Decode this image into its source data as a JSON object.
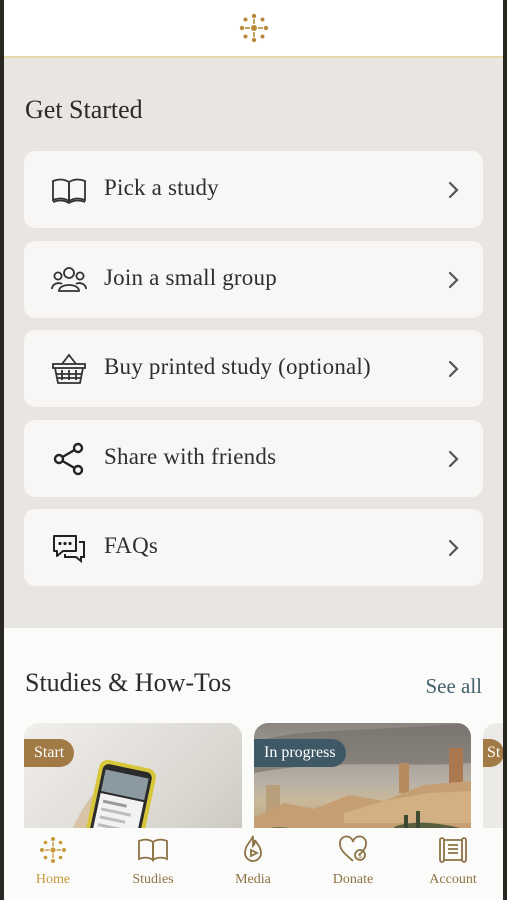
{
  "colors": {
    "accent": "#b7893a",
    "panel": "#e9e6e1",
    "card": "#f8f7f5",
    "link": "#44606b"
  },
  "header": {
    "logo_icon": "sunburst-logo-icon"
  },
  "get_started": {
    "title": "Get Started",
    "items": [
      {
        "label": "Pick a study",
        "icon": "book-open-icon"
      },
      {
        "label": "Join a small group",
        "icon": "group-icon"
      },
      {
        "label": "Buy printed study (optional)",
        "icon": "basket-icon"
      },
      {
        "label": "Share with friends",
        "icon": "share-icon"
      },
      {
        "label": "FAQs",
        "icon": "chat-bubbles-icon"
      }
    ]
  },
  "studies": {
    "title": "Studies & How-Tos",
    "see_all": "See all",
    "cards": [
      {
        "badge": "Start",
        "badge_color": "#a27a45"
      },
      {
        "badge": "In progress",
        "badge_color": "#3f5866"
      },
      {
        "badge": "St",
        "badge_color": "#a27a45"
      }
    ]
  },
  "tabbar": {
    "tabs": [
      {
        "label": "Home",
        "icon": "sunburst-icon",
        "active": true
      },
      {
        "label": "Studies",
        "icon": "book-icon",
        "active": false
      },
      {
        "label": "Media",
        "icon": "media-play-icon",
        "active": false
      },
      {
        "label": "Donate",
        "icon": "heart-donate-icon",
        "active": false
      },
      {
        "label": "Account",
        "icon": "scroll-icon",
        "active": false
      }
    ]
  }
}
